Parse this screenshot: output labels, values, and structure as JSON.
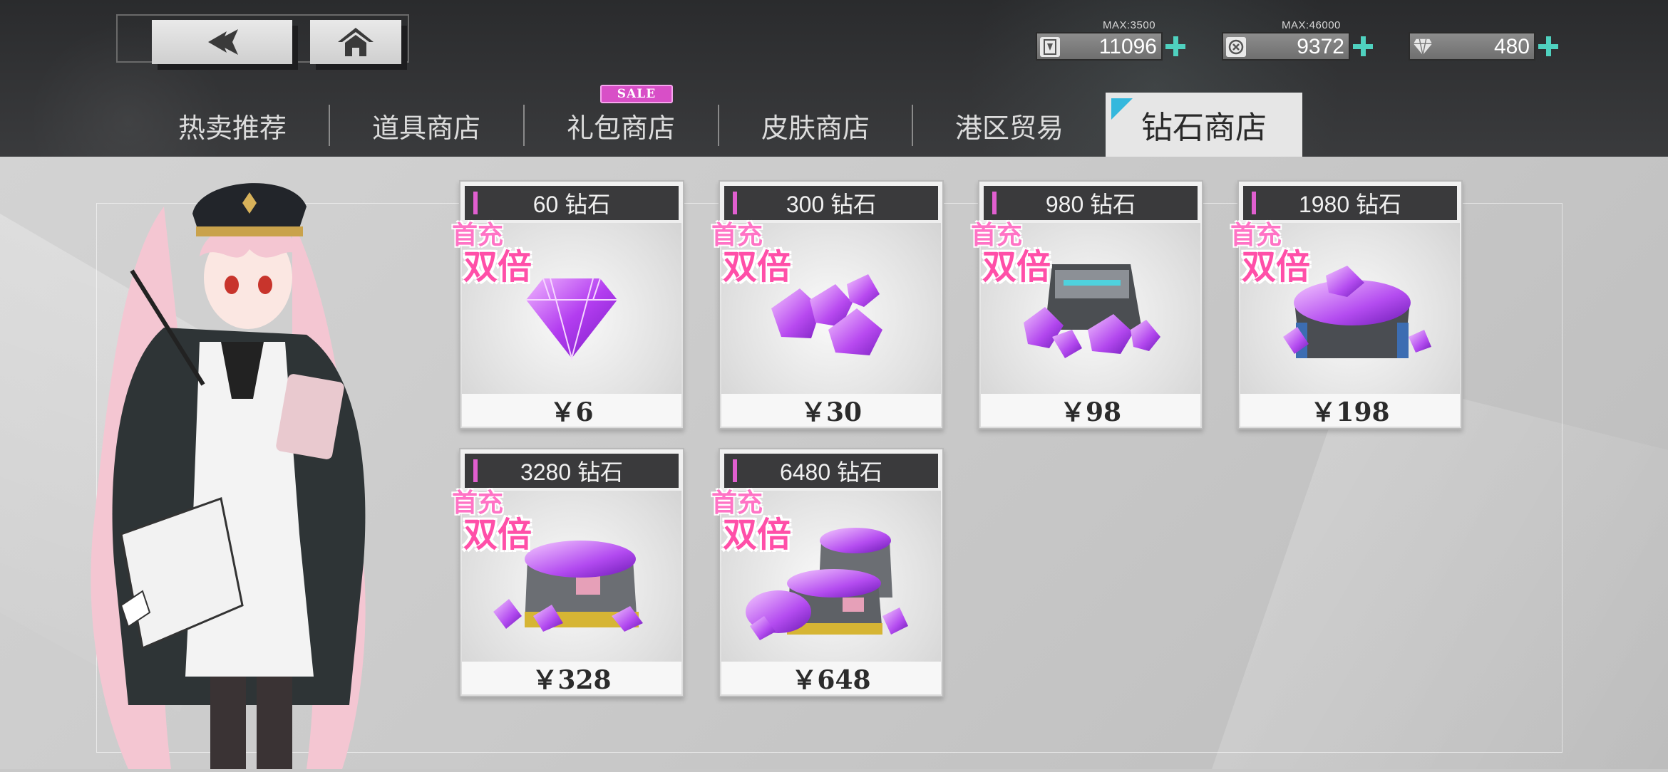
{
  "nav": {
    "back_icon": "back-arrow-icon",
    "home_icon": "home-icon"
  },
  "currencies": [
    {
      "name": "oil",
      "icon": "fuel-icon",
      "value": "11096",
      "max": "MAX:3500"
    },
    {
      "name": "gold",
      "icon": "coin-icon",
      "value": "9372",
      "max": "MAX:46000"
    },
    {
      "name": "diamond",
      "icon": "diamond-icon",
      "value": "480",
      "max": ""
    }
  ],
  "tabs": [
    {
      "label": "热卖推荐"
    },
    {
      "label": "道具商店"
    },
    {
      "label": "礼包商店",
      "badge": "SALE"
    },
    {
      "label": "皮肤商店"
    },
    {
      "label": "港区贸易"
    },
    {
      "label": "钻石商店",
      "active": true
    }
  ],
  "promo": {
    "line1": "首充",
    "line2": "双倍"
  },
  "products": [
    {
      "title": "60 钻石",
      "price": "￥6",
      "art": "single-diamond"
    },
    {
      "title": "300 钻石",
      "price": "￥30",
      "art": "diamond-pile"
    },
    {
      "title": "980 钻石",
      "price": "￥98",
      "art": "diamond-case"
    },
    {
      "title": "1980 钻石",
      "price": "￥198",
      "art": "diamond-crate"
    },
    {
      "title": "3280 钻石",
      "price": "￥328",
      "art": "diamond-box"
    },
    {
      "title": "6480 钻石",
      "price": "￥648",
      "art": "diamond-boxes"
    }
  ],
  "colors": {
    "accent_teal": "#4fd1bf",
    "sale_pink": "#d84fc7",
    "promo_pink": "#ff4fa8",
    "active_tab_corner": "#35b8dd"
  }
}
